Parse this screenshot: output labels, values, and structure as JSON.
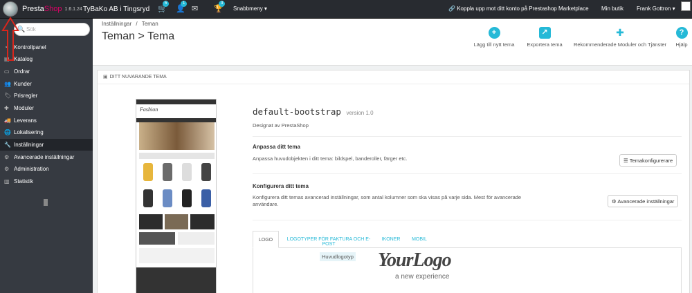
{
  "topbar": {
    "brand_presta": "Presta",
    "brand_shop": "Shop",
    "version": "1.6.1.24",
    "shop_name": "TyBaKo AB i Tingsryd",
    "orders_badge": "5",
    "customers_badge": "1",
    "messages_badge": "3",
    "quick_menu": "Snabbmeny ▾",
    "marketplace": "Koppla upp mot ditt konto på Prestashop Marketplace",
    "my_shop": "Min butik",
    "user": "Frank Gottron ▾"
  },
  "sidebar": {
    "search_placeholder": "Sök",
    "items": [
      {
        "label": "Kontrollpanel",
        "icon": "dashboard-icon"
      },
      {
        "label": "Katalog",
        "icon": "catalog-icon"
      },
      {
        "label": "Ordrar",
        "icon": "orders-icon"
      },
      {
        "label": "Kunder",
        "icon": "customers-icon"
      },
      {
        "label": "Prisregler",
        "icon": "price-rules-icon"
      },
      {
        "label": "Moduler",
        "icon": "modules-icon"
      },
      {
        "label": "Leverans",
        "icon": "shipping-icon"
      },
      {
        "label": "Lokalisering",
        "icon": "localization-icon"
      },
      {
        "label": "Inställningar",
        "icon": "wrench-icon"
      },
      {
        "label": "Avancerade inställningar",
        "icon": "gears-icon"
      },
      {
        "label": "Administration",
        "icon": "admin-icon"
      },
      {
        "label": "Statistik",
        "icon": "stats-icon"
      }
    ]
  },
  "header": {
    "breadcrumb_1": "Inställningar",
    "breadcrumb_sep": "/",
    "breadcrumb_2": "Teman",
    "title": "Teman > Tema",
    "toolbar": {
      "add_theme": "Lägg till nytt tema",
      "export_theme": "Exportera tema",
      "recommended": "Rekommenderade Moduler och Tjänster",
      "help": "Hjälp"
    }
  },
  "panel": {
    "heading": "DITT NUVARANDE TEMA",
    "theme_name": "default-bootstrap",
    "theme_version": "version 1.0",
    "designed_by": "Designat av PrestaShop",
    "customize_title": "Anpassa ditt tema",
    "customize_desc": "Anpassa huvudobjekten i ditt tema: bildspel, banderoller, färger etc.",
    "customize_button": "Temakonfigurerare",
    "configure_title": "Konfigurera ditt tema",
    "configure_desc": "Konfigurera ditt temas avancerad inställningar, som antal kolumner som ska visas på varje sida. Mest för avancerade användare.",
    "configure_button": "Avancerade inställningar",
    "tabs": [
      "LOGO",
      "LOGOTYPER FÖR FAKTURA OCH E-POST",
      "IKONER",
      "MOBIL"
    ],
    "logo_label": "Huvudlogotyp",
    "logo_text": "YourLogo",
    "logo_tagline": "a new experience",
    "preview_logo": "Fashion"
  },
  "colors": {
    "accent": "#25b9d7",
    "sidebar_bg": "#363a41",
    "topbar_bg": "#282b30",
    "brand_pink": "#df0067"
  }
}
